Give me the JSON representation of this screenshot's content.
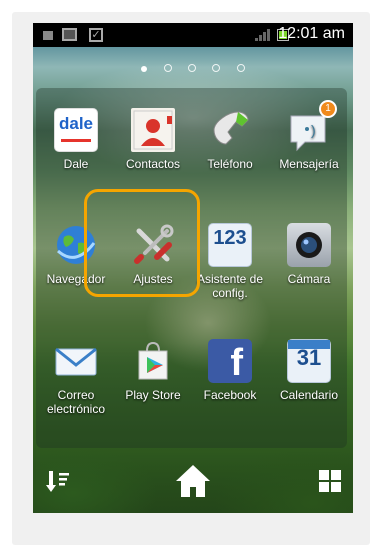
{
  "status_bar": {
    "time": "12:01 am"
  },
  "apps": [
    {
      "id": "dale",
      "label": "Dale",
      "icon_text": "dale"
    },
    {
      "id": "contactos",
      "label": "Contactos"
    },
    {
      "id": "telefono",
      "label": "Teléfono"
    },
    {
      "id": "mensajeria",
      "label": "Mensajería",
      "badge": "1"
    },
    {
      "id": "navegador",
      "label": "Navegador"
    },
    {
      "id": "ajustes",
      "label": "Ajustes"
    },
    {
      "id": "asistente",
      "label": "Asistente de config.",
      "icon_text": "123"
    },
    {
      "id": "camara",
      "label": "Cámara"
    },
    {
      "id": "correo",
      "label": "Correo electrónico"
    },
    {
      "id": "playstore",
      "label": "Play Store"
    },
    {
      "id": "facebook",
      "label": "Facebook",
      "icon_text": "f"
    },
    {
      "id": "calendario",
      "label": "Calendario",
      "icon_text": "31"
    }
  ],
  "colors": {
    "highlight": "#f5a500",
    "dale_blue": "#1f63c9",
    "badge": "#f08a1c"
  },
  "pager": {
    "pages": 5,
    "current": 1
  }
}
